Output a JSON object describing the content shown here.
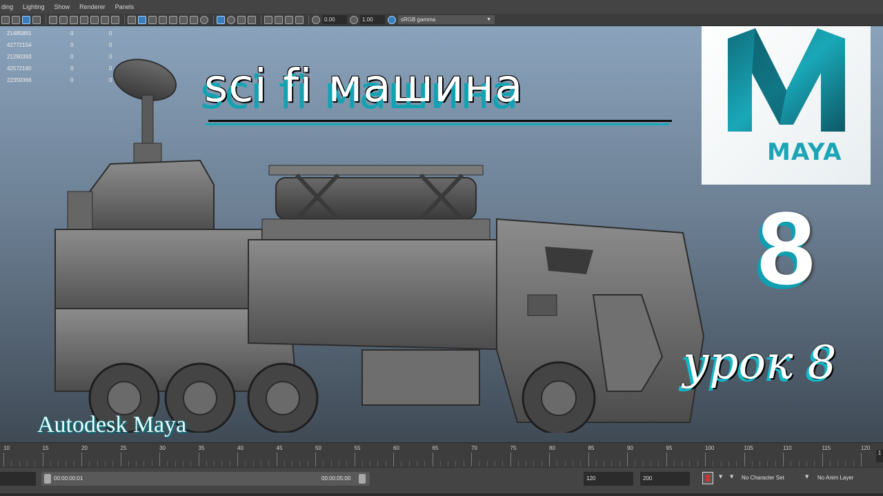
{
  "menu": {
    "items": [
      "ding",
      "Lighting",
      "Show",
      "Renderer",
      "Panels"
    ]
  },
  "toolbar": {
    "exposure_value": "0.00",
    "gamma_value": "1.00",
    "color_space": "sRGB gamma"
  },
  "hud": {
    "rows": [
      [
        "21485891",
        "0",
        "0"
      ],
      [
        "42772154",
        "0",
        "0"
      ],
      [
        "21290393",
        "0",
        "0"
      ],
      [
        "42572180",
        "0",
        "0"
      ],
      [
        "22359366",
        "0",
        "0"
      ]
    ]
  },
  "overlay": {
    "title": "sci fi машина",
    "logo_label": "MAYA",
    "lesson_number": "8",
    "lesson_label": "урок 8",
    "brand_label": "Autodesk Maya"
  },
  "colors": {
    "accent_teal": "#12a3b3",
    "viewport_top": "#8aa3bc",
    "viewport_bottom": "#3f4a55",
    "ui_dark": "#444444"
  },
  "timeline": {
    "ticks": [
      "10",
      "15",
      "20",
      "25",
      "30",
      "35",
      "40",
      "45",
      "50",
      "55",
      "60",
      "65",
      "70",
      "75",
      "80",
      "85",
      "90",
      "95",
      "100",
      "105",
      "110",
      "115",
      "120"
    ],
    "end_label": "1"
  },
  "range": {
    "start_time": "00:00:00:01",
    "end_time": "00:00:05:00",
    "playback_end": "120",
    "anim_end": "200",
    "character_set": "No Character Set",
    "anim_layer": "No Anim Layer"
  }
}
